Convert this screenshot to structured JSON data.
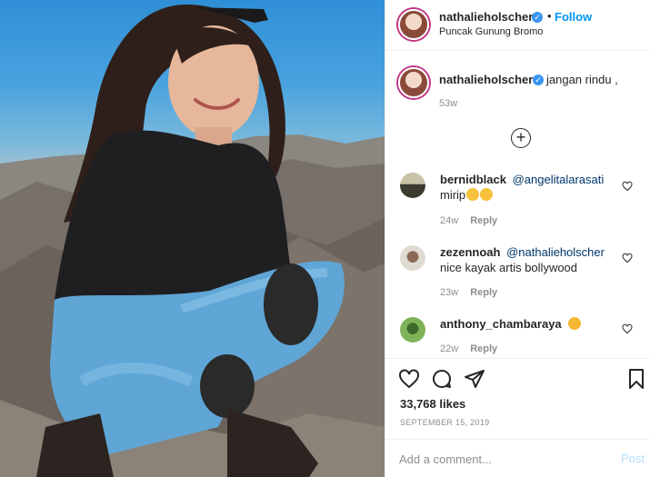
{
  "post": {
    "author": "nathalieholscher",
    "follow_label": "Follow",
    "location": "Puncak Gunung Bromo",
    "verified_glyph": "✓",
    "dot_separator": "•"
  },
  "caption": {
    "author": "nathalieholscher",
    "text": "jangan rindu ,",
    "time": "53w"
  },
  "load_more_label": "+",
  "comments": [
    {
      "user": "bernidblack",
      "mention": "@angelitalarasati",
      "text": "mirip",
      "emojis": 2,
      "time": "24w",
      "reply": "Reply",
      "avatar_color": "#3b3a2f"
    },
    {
      "user": "zezennoah",
      "mention": "@nathalieholscher",
      "text": "nice kayak artis bollywood",
      "emojis": 0,
      "time": "23w",
      "reply": "Reply",
      "avatar_color": "#c9c2b5"
    },
    {
      "user": "anthony_chambaraya",
      "mention": "",
      "text": "",
      "emojis": 1,
      "time": "22w",
      "reply": "Reply",
      "avatar_color": "#4f8f3a"
    }
  ],
  "likes": "33,768 likes",
  "date": "SEPTEMBER 15, 2019",
  "add_comment_placeholder": "Add a comment...",
  "post_label": "Post",
  "icons": [
    "heart-icon",
    "comment-icon",
    "share-icon",
    "bookmark-icon",
    "plus-circle-icon"
  ],
  "colors": {
    "link": "#0095f6",
    "mention": "#00376b",
    "muted": "#8e8e8e",
    "verified": "#3897f0",
    "post_disabled": "#b2dffc"
  }
}
